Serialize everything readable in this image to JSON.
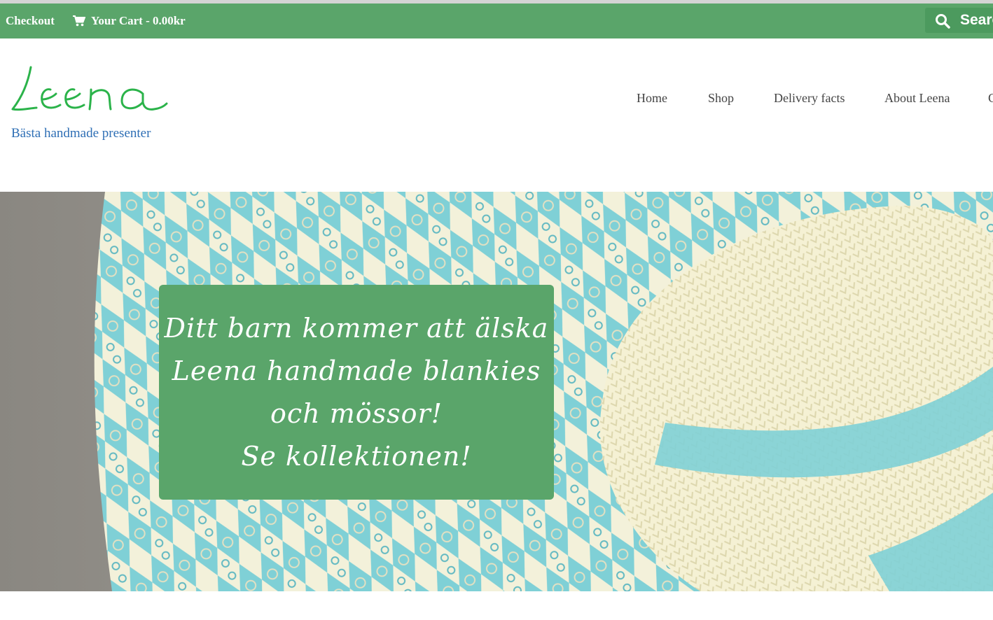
{
  "topbar": {
    "checkout_label": "Checkout",
    "cart_label": "Your Cart - 0.00kr",
    "cart_icon": "cart-icon",
    "search_label": "Search",
    "search_icon": "search-icon",
    "background": "#5aa56a"
  },
  "header": {
    "logo_text": "Leena",
    "tagline": "Bästa handmade presenter",
    "logo_color": "#2bb34a",
    "tagline_color": "#2f6fb5"
  },
  "nav": {
    "items": [
      {
        "label": "Home"
      },
      {
        "label": "Shop"
      },
      {
        "label": "Delivery facts"
      },
      {
        "label": "About Leena"
      },
      {
        "label": "C"
      }
    ]
  },
  "hero": {
    "banner_lines": [
      "Ditt barn kommer att älska",
      "Leena handmade blankies",
      "och mössor!",
      "Se kollektionen!"
    ],
    "banner_color": "#5aa56a",
    "yarn_colors": [
      "#7fd0d6",
      "#f3f1da"
    ]
  }
}
